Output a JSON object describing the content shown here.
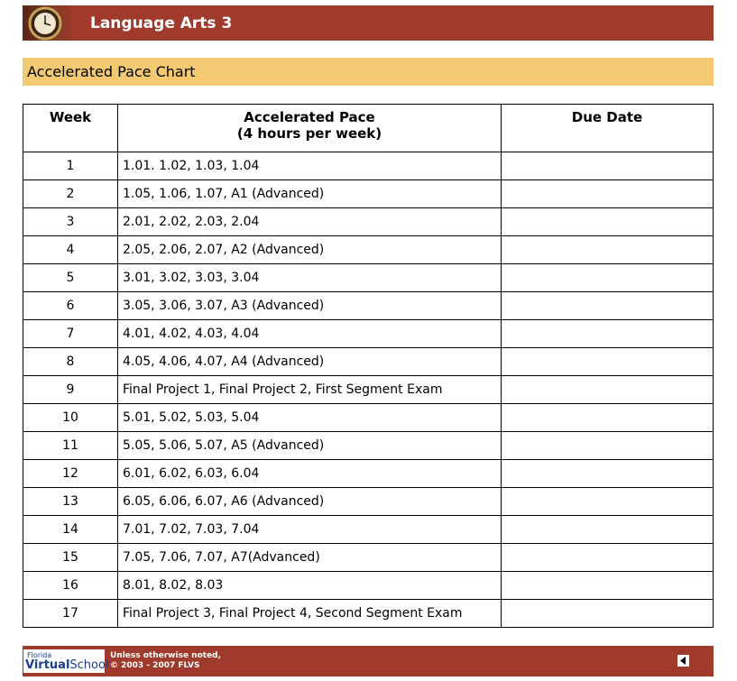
{
  "header": {
    "title": "Language Arts 3",
    "icon": "clock-icon"
  },
  "subheader": {
    "title": "Accelerated Pace Chart"
  },
  "table": {
    "columns": [
      {
        "line1": "Week",
        "line2": ""
      },
      {
        "line1": "Accelerated Pace",
        "line2": "(4 hours per week)"
      },
      {
        "line1": "Due Date",
        "line2": ""
      }
    ],
    "rows": [
      {
        "week": "1",
        "pace": "1.01. 1.02, 1.03, 1.04",
        "due": ""
      },
      {
        "week": "2",
        "pace": "1.05, 1.06, 1.07, A1 (Advanced)",
        "due": ""
      },
      {
        "week": "3",
        "pace": "2.01, 2.02, 2.03, 2.04",
        "due": ""
      },
      {
        "week": "4",
        "pace": "2.05, 2.06, 2.07, A2 (Advanced)",
        "due": ""
      },
      {
        "week": "5",
        "pace": "3.01, 3.02, 3.03, 3.04",
        "due": ""
      },
      {
        "week": "6",
        "pace": "3.05, 3.06, 3.07, A3 (Advanced)",
        "due": ""
      },
      {
        "week": "7",
        "pace": "4.01, 4.02, 4.03, 4.04",
        "due": ""
      },
      {
        "week": "8",
        "pace": "4.05, 4.06, 4.07, A4 (Advanced)",
        "due": ""
      },
      {
        "week": "9",
        "pace": "Final Project 1, Final Project 2, First Segment Exam",
        "due": ""
      },
      {
        "week": "10",
        "pace": "5.01, 5.02, 5.03, 5.04",
        "due": ""
      },
      {
        "week": "11",
        "pace": "5.05, 5.06, 5.07, A5 (Advanced)",
        "due": ""
      },
      {
        "week": "12",
        "pace": "6.01, 6.02, 6.03, 6.04",
        "due": ""
      },
      {
        "week": "13",
        "pace": "6.05, 6.06, 6.07, A6 (Advanced)",
        "due": ""
      },
      {
        "week": "14",
        "pace": "7.01, 7.02, 7.03, 7.04",
        "due": ""
      },
      {
        "week": "15",
        "pace": "7.05, 7.06, 7.07, A7(Advanced)",
        "due": ""
      },
      {
        "week": "16",
        "pace": "8.01, 8.02, 8.03",
        "due": ""
      },
      {
        "week": "17",
        "pace": "Final Project 3, Final Project 4, Second Segment Exam",
        "due": ""
      }
    ]
  },
  "footer": {
    "logo_small": "Florida",
    "logo_virtual": "Virtual",
    "logo_school": "School",
    "notice_line1": "Unless otherwise noted,",
    "notice_line2": "© 2003 - 2007 FLVS",
    "back_icon": "back-arrow-icon"
  },
  "colors": {
    "header": "#a03a2c",
    "subheader": "#f3ca72",
    "footer": "#a03a2c"
  }
}
